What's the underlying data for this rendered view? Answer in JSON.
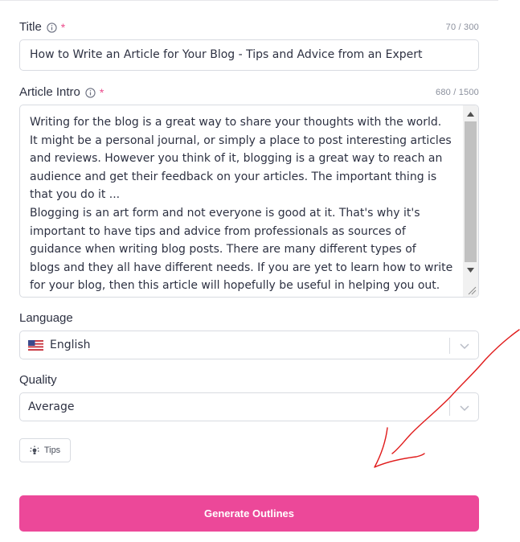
{
  "form": {
    "title": {
      "label": "Title",
      "required_mark": "*",
      "counter": "70 / 300",
      "value": "How to Write an Article for Your Blog - Tips and Advice from an Expert"
    },
    "intro": {
      "label": "Article Intro",
      "required_mark": "*",
      "counter": "680 / 1500",
      "value": "Writing for the blog is a great way to share your thoughts with the world.\nIt might be a personal journal, or simply a place to post interesting articles\nand reviews. However you think of it, blogging is a great way to reach an\naudience and get their feedback on your articles. The important thing is\nthat you do it ...\nBlogging is an art form and not everyone is good at it. That's why it's\nimportant to have tips and advice from professionals as sources of\nguidance when writing blog posts. There are many different types of\nblogs and they all have different needs. If you are yet to learn how to write\nfor your blog, then this article will hopefully be useful in helping you out."
    },
    "language": {
      "label": "Language",
      "value": "English",
      "flag_icon": "us-flag-icon"
    },
    "quality": {
      "label": "Quality",
      "value": "Average"
    },
    "tips": {
      "label": "Tips",
      "icon": "lightbulb-icon"
    },
    "generate": {
      "label": "Generate Outlines"
    }
  },
  "colors": {
    "accent": "#ec4899",
    "required": "#ec4b8c",
    "annotation": "#e01b1b"
  }
}
